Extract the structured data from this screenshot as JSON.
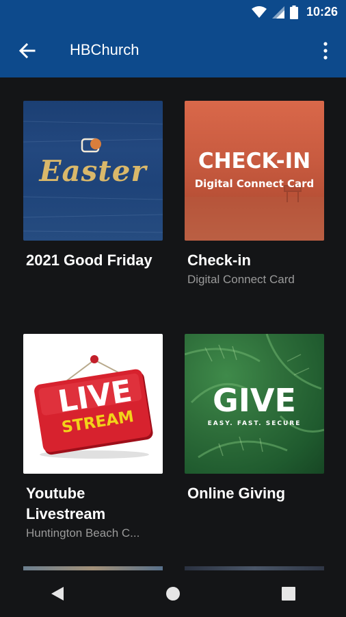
{
  "status_bar": {
    "time": "10:26"
  },
  "app_bar": {
    "title": "HBChurch"
  },
  "cards": [
    {
      "title": "2021 Good Friday",
      "subtitle": "",
      "image_text": "Easter"
    },
    {
      "title": "Check-in",
      "subtitle": "Digital Connect Card",
      "image_text": "CHECK-IN",
      "image_subtext": "Digital Connect Card"
    },
    {
      "title": "Youtube Livestream",
      "subtitle": "Huntington Beach C...",
      "image_text": "LIVE",
      "image_subtext": "STREAM"
    },
    {
      "title": "Online Giving",
      "subtitle": "",
      "image_text": "GIVE",
      "image_subtext": "EASY. FAST. SECURE"
    }
  ],
  "colors": {
    "app_bar": "#0d4a8c",
    "background": "#141517"
  },
  "icons": {
    "back": "arrow-left-icon",
    "menu": "more-vert-icon",
    "nav_back": "triangle-back-icon",
    "nav_home": "circle-home-icon",
    "nav_recents": "square-recents-icon"
  }
}
